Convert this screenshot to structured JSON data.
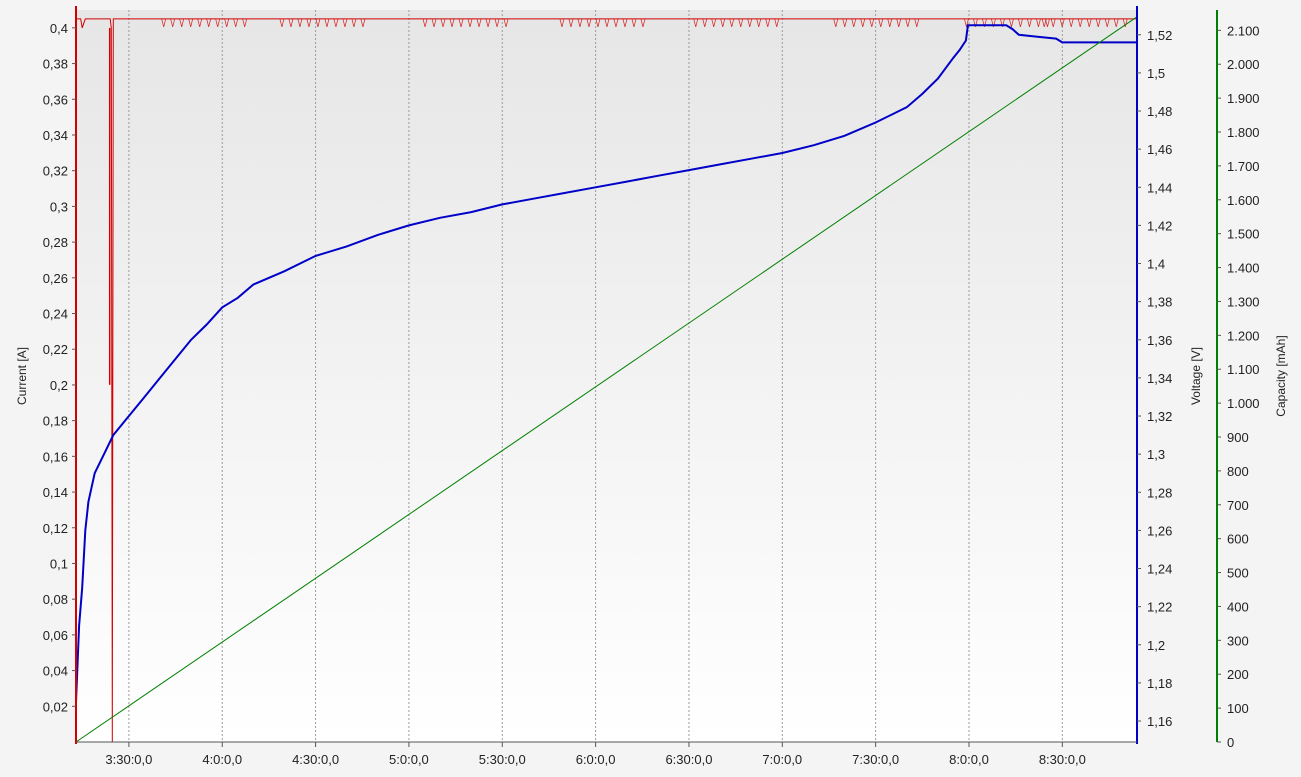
{
  "chart_data": {
    "type": "line",
    "grid": {
      "vertical": true,
      "horizontal": false,
      "style": "dotted"
    },
    "x_axis": {
      "label": "",
      "range": [
        "3:13:00",
        "8:54:00"
      ],
      "ticks": [
        {
          "t": "3:30:00",
          "label": "3:30:0,0"
        },
        {
          "t": "4:00:00",
          "label": "4:0:0,0"
        },
        {
          "t": "4:30:00",
          "label": "4:30:0,0"
        },
        {
          "t": "5:00:00",
          "label": "5:0:0,0"
        },
        {
          "t": "5:30:00",
          "label": "5:30:0,0"
        },
        {
          "t": "6:00:00",
          "label": "6:0:0,0"
        },
        {
          "t": "6:30:00",
          "label": "6:30:0,0"
        },
        {
          "t": "7:00:00",
          "label": "7:0:0,0"
        },
        {
          "t": "7:30:00",
          "label": "7:30:0,0"
        },
        {
          "t": "8:00:00",
          "label": "8:0:0,0"
        },
        {
          "t": "8:30:00",
          "label": "8:30:0,0"
        }
      ]
    },
    "y_axes": {
      "current": {
        "label": "Current [A]",
        "side": "left",
        "color": "#d40000",
        "range": [
          0,
          0.41
        ],
        "ticks": [
          {
            "v": 0.02,
            "label": "0,02"
          },
          {
            "v": 0.04,
            "label": "0,04"
          },
          {
            "v": 0.06,
            "label": "0,06"
          },
          {
            "v": 0.08,
            "label": "0,08"
          },
          {
            "v": 0.1,
            "label": "0,1"
          },
          {
            "v": 0.12,
            "label": "0,12"
          },
          {
            "v": 0.14,
            "label": "0,14"
          },
          {
            "v": 0.16,
            "label": "0,16"
          },
          {
            "v": 0.18,
            "label": "0,18"
          },
          {
            "v": 0.2,
            "label": "0,2"
          },
          {
            "v": 0.22,
            "label": "0,22"
          },
          {
            "v": 0.24,
            "label": "0,24"
          },
          {
            "v": 0.26,
            "label": "0,26"
          },
          {
            "v": 0.28,
            "label": "0,28"
          },
          {
            "v": 0.3,
            "label": "0,3"
          },
          {
            "v": 0.32,
            "label": "0,32"
          },
          {
            "v": 0.34,
            "label": "0,34"
          },
          {
            "v": 0.36,
            "label": "0,36"
          },
          {
            "v": 0.38,
            "label": "0,38"
          },
          {
            "v": 0.4,
            "label": "0,4"
          }
        ]
      },
      "voltage": {
        "label": "Voltage [V]",
        "side": "right",
        "color": "#0000c8",
        "range": [
          1.149,
          1.533
        ],
        "ticks": [
          {
            "v": 1.16,
            "label": "1,16"
          },
          {
            "v": 1.18,
            "label": "1,18"
          },
          {
            "v": 1.2,
            "label": "1,2"
          },
          {
            "v": 1.22,
            "label": "1,22"
          },
          {
            "v": 1.24,
            "label": "1,24"
          },
          {
            "v": 1.26,
            "label": "1,26"
          },
          {
            "v": 1.28,
            "label": "1,28"
          },
          {
            "v": 1.3,
            "label": "1,3"
          },
          {
            "v": 1.32,
            "label": "1,32"
          },
          {
            "v": 1.34,
            "label": "1,34"
          },
          {
            "v": 1.36,
            "label": "1,36"
          },
          {
            "v": 1.38,
            "label": "1,38"
          },
          {
            "v": 1.4,
            "label": "1,4"
          },
          {
            "v": 1.42,
            "label": "1,42"
          },
          {
            "v": 1.44,
            "label": "1,44"
          },
          {
            "v": 1.46,
            "label": "1,46"
          },
          {
            "v": 1.48,
            "label": "1,48"
          },
          {
            "v": 1.5,
            "label": "1,5"
          },
          {
            "v": 1.52,
            "label": "1,52"
          }
        ]
      },
      "capacity": {
        "label": "Capacity [mAh]",
        "side": "right",
        "color": "#008000",
        "range": [
          0,
          2160
        ],
        "ticks": [
          {
            "v": 0,
            "label": "0"
          },
          {
            "v": 100,
            "label": "100"
          },
          {
            "v": 200,
            "label": "200"
          },
          {
            "v": 300,
            "label": "300"
          },
          {
            "v": 400,
            "label": "400"
          },
          {
            "v": 500,
            "label": "500"
          },
          {
            "v": 600,
            "label": "600"
          },
          {
            "v": 700,
            "label": "700"
          },
          {
            "v": 800,
            "label": "800"
          },
          {
            "v": 900,
            "label": "900"
          },
          {
            "v": 1000,
            "label": "1.000"
          },
          {
            "v": 1100,
            "label": "1.100"
          },
          {
            "v": 1200,
            "label": "1.200"
          },
          {
            "v": 1300,
            "label": "1.300"
          },
          {
            "v": 1400,
            "label": "1.400"
          },
          {
            "v": 1500,
            "label": "1.500"
          },
          {
            "v": 1600,
            "label": "1.600"
          },
          {
            "v": 1700,
            "label": "1.700"
          },
          {
            "v": 1800,
            "label": "1.800"
          },
          {
            "v": 1900,
            "label": "1.900"
          },
          {
            "v": 2000,
            "label": "2.000"
          },
          {
            "v": 2100,
            "label": "2.100"
          }
        ]
      }
    },
    "series": [
      {
        "axis": "current",
        "color": "#d40000",
        "points": [
          [
            "3:13:00",
            0.36
          ],
          [
            "3:13:10",
            0.405
          ],
          [
            "3:14:30",
            0.405
          ],
          [
            "3:15:00",
            0.4
          ],
          [
            "3:16:00",
            0.405
          ],
          [
            "3:24:00",
            0.405
          ],
          [
            "3:24:20",
            0.4
          ],
          [
            "3:24:40",
            0.0
          ],
          [
            "3:25:00",
            0.405
          ],
          [
            "8:54:00",
            0.405
          ]
        ],
        "spike_markers": [
          [
            "3:23:50",
            0.2
          ]
        ],
        "ripple_clusters": [
          "3:55:00",
          "4:33:00",
          "5:19:00",
          "6:03:00",
          "6:46:00",
          "7:31:00",
          "8:13:00",
          "8:38:00"
        ]
      },
      {
        "axis": "voltage",
        "color": "#0000c8",
        "points": [
          [
            "3:13:00",
            1.17
          ],
          [
            "3:14:00",
            1.21
          ],
          [
            "3:15:00",
            1.23
          ],
          [
            "3:16:00",
            1.26
          ],
          [
            "3:17:00",
            1.275
          ],
          [
            "3:19:00",
            1.29
          ],
          [
            "3:22:00",
            1.3
          ],
          [
            "3:25:00",
            1.31
          ],
          [
            "3:30:00",
            1.32
          ],
          [
            "3:35:00",
            1.33
          ],
          [
            "3:40:00",
            1.34
          ],
          [
            "3:45:00",
            1.35
          ],
          [
            "3:50:00",
            1.36
          ],
          [
            "3:55:00",
            1.368
          ],
          [
            "4:00:00",
            1.377
          ],
          [
            "4:05:00",
            1.382
          ],
          [
            "4:10:00",
            1.389
          ],
          [
            "4:20:00",
            1.396
          ],
          [
            "4:30:00",
            1.404
          ],
          [
            "4:40:00",
            1.409
          ],
          [
            "4:50:00",
            1.415
          ],
          [
            "5:00:00",
            1.42
          ],
          [
            "5:10:00",
            1.424
          ],
          [
            "5:20:00",
            1.427
          ],
          [
            "5:30:00",
            1.431
          ],
          [
            "5:40:00",
            1.434
          ],
          [
            "5:50:00",
            1.437
          ],
          [
            "6:00:00",
            1.44
          ],
          [
            "6:10:00",
            1.443
          ],
          [
            "6:20:00",
            1.446
          ],
          [
            "6:30:00",
            1.449
          ],
          [
            "6:40:00",
            1.452
          ],
          [
            "6:50:00",
            1.455
          ],
          [
            "7:00:00",
            1.458
          ],
          [
            "7:10:00",
            1.462
          ],
          [
            "7:20:00",
            1.467
          ],
          [
            "7:30:00",
            1.474
          ],
          [
            "7:40:00",
            1.482
          ],
          [
            "7:45:00",
            1.489
          ],
          [
            "7:50:00",
            1.497
          ],
          [
            "7:55:00",
            1.508
          ],
          [
            "7:57:00",
            1.512
          ],
          [
            "7:59:00",
            1.517
          ],
          [
            "7:59:40",
            1.525
          ],
          [
            "8:12:00",
            1.525
          ],
          [
            "8:14:00",
            1.523
          ],
          [
            "8:16:00",
            1.52
          ],
          [
            "8:22:00",
            1.519
          ],
          [
            "8:28:00",
            1.518
          ],
          [
            "8:30:00",
            1.516
          ],
          [
            "8:54:00",
            1.516
          ]
        ]
      },
      {
        "axis": "capacity",
        "color": "#008000",
        "points": [
          [
            "3:13:00",
            0
          ],
          [
            "8:54:00",
            2140
          ]
        ]
      }
    ]
  }
}
